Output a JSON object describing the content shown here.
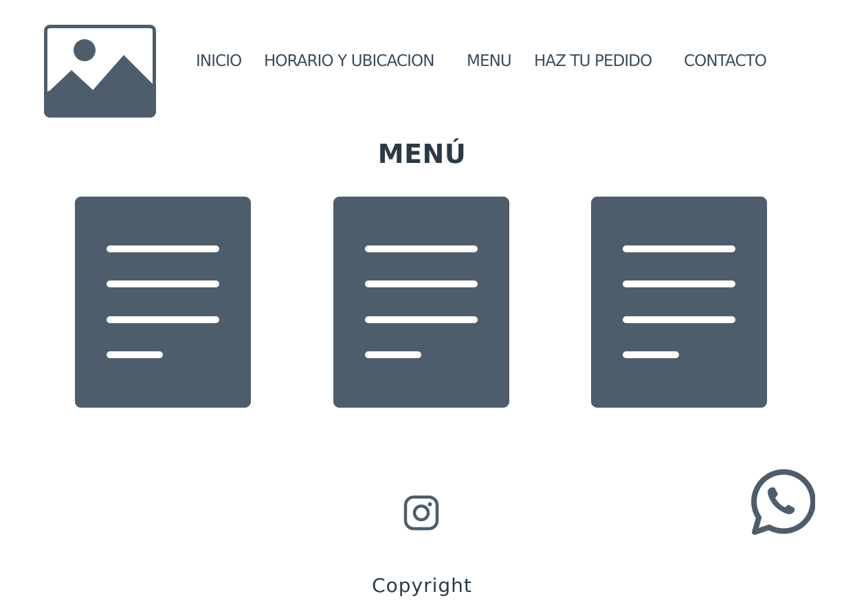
{
  "logo": {
    "icon": "image-placeholder-icon"
  },
  "nav": {
    "items": [
      {
        "label": "INICIO"
      },
      {
        "label": "HORARIO Y UBICACION"
      },
      {
        "label": "MENU"
      },
      {
        "label": "HAZ TU PEDIDO"
      },
      {
        "label": "CONTACTO"
      }
    ]
  },
  "page": {
    "title": "MENÚ"
  },
  "cards": [
    {
      "icon": "document-lines-icon"
    },
    {
      "icon": "document-lines-icon"
    },
    {
      "icon": "document-lines-icon"
    }
  ],
  "social": {
    "instagram_icon": "instagram-icon",
    "whatsapp_icon": "whatsapp-icon"
  },
  "footer": {
    "copyright": "Copyright"
  },
  "colors": {
    "primary": "#4d5d6b",
    "text": "#2c3a47",
    "nav_text": "#3a4d5e",
    "background": "#ffffff"
  }
}
